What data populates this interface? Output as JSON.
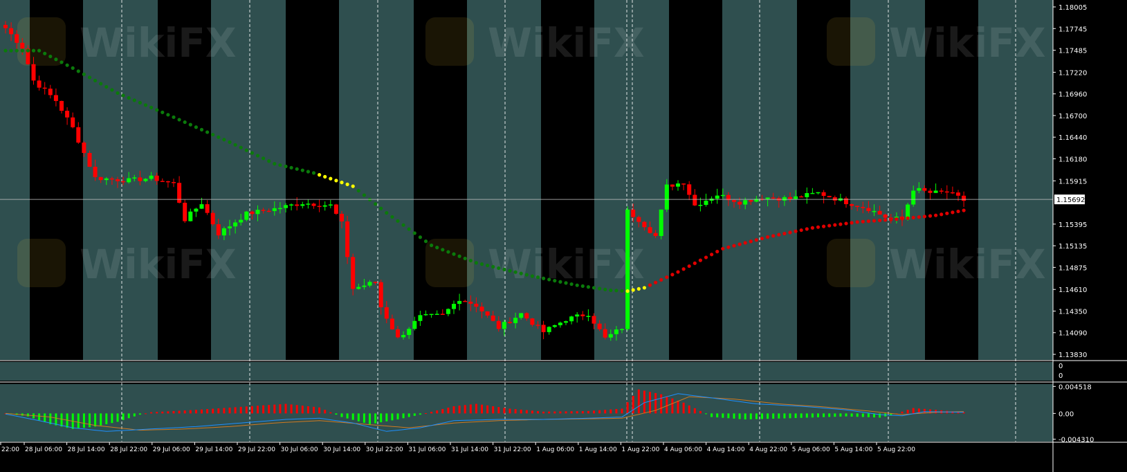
{
  "colors": {
    "background": "#2f4f4f",
    "session_band": "#000000",
    "candle_up": "#00ff00",
    "candle_down": "#ff0000",
    "ma_down": "#0b7a0b",
    "ma_up": "#e00000",
    "ma_flat": "#ffff00",
    "macd_line": "#1e90ff",
    "signal_line": "#d07a20",
    "hist_pos": "#ff0000",
    "hist_neg": "#00ff00",
    "grid": "#ffffff",
    "axis_text": "#ffffff",
    "price_marker": "#c0c0c0"
  },
  "watermark": {
    "text": "WikiFX",
    "logo": "wikifx-shield-logo"
  },
  "chart_data": [
    {
      "type": "candlestick",
      "name": "price",
      "ylim": [
        1.1383,
        1.18005
      ],
      "y_ticks": [
        "1.18005",
        "1.17745",
        "1.17485",
        "1.17220",
        "1.16960",
        "1.16700",
        "1.16440",
        "1.16180",
        "1.15915",
        "1.15395",
        "1.15135",
        "1.14875",
        "1.14610",
        "1.14350",
        "1.14090",
        "1.13830"
      ],
      "y_tick_values": [
        1.18005,
        1.17745,
        1.17485,
        1.1722,
        1.1696,
        1.167,
        1.1644,
        1.1618,
        1.15915,
        1.15395,
        1.15135,
        1.14875,
        1.1461,
        1.1435,
        1.1409,
        1.1383
      ],
      "current_price_label": "1.15692",
      "current_price": 1.15692,
      "x_labels": [
        "22:00",
        "28 Jul 06:00",
        "28 Jul 14:00",
        "28 Jul 22:00",
        "29 Jul 06:00",
        "29 Jul 14:00",
        "29 Jul 22:00",
        "30 Jul 06:00",
        "30 Jul 14:00",
        "30 Jul 22:00",
        "31 Jul 06:00",
        "31 Jul 14:00",
        "31 Jul 22:00",
        "1 Aug 06:00",
        "1 Aug 14:00",
        "1 Aug 22:00",
        "4 Aug 06:00",
        "4 Aug 14:00",
        "4 Aug 22:00",
        "5 Aug 06:00",
        "5 Aug 14:00",
        "5 Aug 22:00"
      ],
      "close_anchors": [
        [
          0,
          1.1775
        ],
        [
          3,
          1.1752
        ],
        [
          5,
          1.1712
        ],
        [
          9,
          1.1688
        ],
        [
          12,
          1.1655
        ],
        [
          16,
          1.1595
        ],
        [
          22,
          1.1592
        ],
        [
          26,
          1.1595
        ],
        [
          30,
          1.1588
        ],
        [
          32,
          1.1545
        ],
        [
          35,
          1.1565
        ],
        [
          38,
          1.1528
        ],
        [
          43,
          1.1552
        ],
        [
          48,
          1.1558
        ],
        [
          53,
          1.1565
        ],
        [
          58,
          1.1562
        ],
        [
          60,
          1.154
        ],
        [
          62,
          1.1462
        ],
        [
          66,
          1.147
        ],
        [
          67,
          1.144
        ],
        [
          70,
          1.1402
        ],
        [
          74,
          1.1428
        ],
        [
          78,
          1.143
        ],
        [
          81,
          1.145
        ],
        [
          84,
          1.1442
        ],
        [
          88,
          1.1415
        ],
        [
          92,
          1.1432
        ],
        [
          96,
          1.141
        ],
        [
          100,
          1.1425
        ],
        [
          104,
          1.1432
        ],
        [
          107,
          1.1402
        ],
        [
          110,
          1.1415
        ],
        [
          111,
          1.1555
        ],
        [
          113,
          1.1545
        ],
        [
          116,
          1.1525
        ],
        [
          118,
          1.1585
        ],
        [
          121,
          1.159
        ],
        [
          123,
          1.1562
        ],
        [
          127,
          1.1575
        ],
        [
          131,
          1.1566
        ],
        [
          135,
          1.1572
        ],
        [
          140,
          1.157
        ],
        [
          145,
          1.1577
        ],
        [
          150,
          1.1566
        ],
        [
          154,
          1.1558
        ],
        [
          157,
          1.1548
        ],
        [
          160,
          1.1545
        ],
        [
          162,
          1.1582
        ],
        [
          165,
          1.1577
        ],
        [
          168,
          1.1578
        ],
        [
          171,
          1.1568
        ]
      ],
      "candle_count": 172,
      "moving_average": {
        "anchors": [
          [
            0,
            1.1748
          ],
          [
            6,
            1.1748
          ],
          [
            12,
            1.1727
          ],
          [
            20,
            1.1697
          ],
          [
            30,
            1.1668
          ],
          [
            40,
            1.1638
          ],
          [
            48,
            1.1612
          ],
          [
            55,
            1.1601
          ],
          [
            62,
            1.1585
          ],
          [
            68,
            1.1553
          ],
          [
            76,
            1.1514
          ],
          [
            84,
            1.1493
          ],
          [
            94,
            1.1477
          ],
          [
            102,
            1.1466
          ],
          [
            108,
            1.146
          ],
          [
            111,
            1.1459
          ],
          [
            114,
            1.1463
          ],
          [
            120,
            1.1482
          ],
          [
            128,
            1.151
          ],
          [
            136,
            1.1524
          ],
          [
            144,
            1.1535
          ],
          [
            152,
            1.1542
          ],
          [
            160,
            1.1546
          ],
          [
            166,
            1.155
          ],
          [
            171,
            1.1556
          ]
        ],
        "color_segments": [
          [
            0,
            55,
            "down"
          ],
          [
            56,
            62,
            "flat"
          ],
          [
            63,
            110,
            "down"
          ],
          [
            111,
            114,
            "flat"
          ],
          [
            115,
            171,
            "up"
          ]
        ]
      }
    },
    {
      "type": "macd",
      "name": "MACD",
      "y_ticks": [
        "0.004518",
        "0.00",
        "-0.004310"
      ],
      "y_tick_values": [
        0.004518,
        0,
        -0.00431
      ],
      "ylim": [
        -0.0047,
        0.0049
      ],
      "histogram_anchors": [
        [
          0,
          0.0
        ],
        [
          4,
          -0.0005
        ],
        [
          8,
          -0.0018
        ],
        [
          12,
          -0.0026
        ],
        [
          16,
          -0.0022
        ],
        [
          20,
          -0.0014
        ],
        [
          24,
          -0.0002
        ],
        [
          26,
          0.0002
        ],
        [
          34,
          0.0006
        ],
        [
          42,
          0.0011
        ],
        [
          50,
          0.0016
        ],
        [
          56,
          0.001
        ],
        [
          60,
          -0.0006
        ],
        [
          65,
          -0.0018
        ],
        [
          70,
          -0.001
        ],
        [
          74,
          -0.0002
        ],
        [
          80,
          0.0012
        ],
        [
          84,
          0.0016
        ],
        [
          90,
          0.0008
        ],
        [
          96,
          0.0003
        ],
        [
          104,
          0.0004
        ],
        [
          110,
          0.0008
        ],
        [
          113,
          0.004
        ],
        [
          117,
          0.0032
        ],
        [
          121,
          0.0018
        ],
        [
          124,
          0.0004
        ],
        [
          126,
          -0.0006
        ],
        [
          132,
          -0.001
        ],
        [
          140,
          -0.0008
        ],
        [
          150,
          -0.0005
        ],
        [
          156,
          -0.0007
        ],
        [
          158,
          -0.0003
        ],
        [
          162,
          0.0009
        ],
        [
          166,
          0.0006
        ],
        [
          171,
          0.0002
        ]
      ],
      "macd_anchors": [
        [
          0,
          -0.0001
        ],
        [
          6,
          -0.0012
        ],
        [
          12,
          -0.0024
        ],
        [
          18,
          -0.003
        ],
        [
          26,
          -0.0026
        ],
        [
          34,
          -0.0022
        ],
        [
          42,
          -0.0016
        ],
        [
          50,
          -0.001
        ],
        [
          56,
          -0.0008
        ],
        [
          62,
          -0.0016
        ],
        [
          68,
          -0.003
        ],
        [
          74,
          -0.0024
        ],
        [
          80,
          -0.0012
        ],
        [
          88,
          -0.001
        ],
        [
          96,
          -0.001
        ],
        [
          104,
          -0.0008
        ],
        [
          110,
          -0.0006
        ],
        [
          114,
          0.0018
        ],
        [
          120,
          0.0033
        ],
        [
          126,
          0.0026
        ],
        [
          134,
          0.0016
        ],
        [
          142,
          0.0012
        ],
        [
          150,
          0.0006
        ],
        [
          156,
          -0.0002
        ],
        [
          160,
          -0.0004
        ],
        [
          164,
          0.0003
        ],
        [
          171,
          0.0002
        ]
      ],
      "signal_anchors": [
        [
          0,
          0.0
        ],
        [
          8,
          -0.0006
        ],
        [
          16,
          -0.002
        ],
        [
          24,
          -0.0028
        ],
        [
          32,
          -0.0026
        ],
        [
          40,
          -0.0022
        ],
        [
          48,
          -0.0016
        ],
        [
          56,
          -0.0012
        ],
        [
          64,
          -0.0018
        ],
        [
          72,
          -0.0024
        ],
        [
          80,
          -0.0016
        ],
        [
          88,
          -0.0012
        ],
        [
          96,
          -0.001
        ],
        [
          104,
          -0.0009
        ],
        [
          110,
          -0.0008
        ],
        [
          116,
          0.0005
        ],
        [
          122,
          0.0028
        ],
        [
          130,
          0.0024
        ],
        [
          138,
          0.0016
        ],
        [
          146,
          0.0011
        ],
        [
          154,
          0.0004
        ],
        [
          160,
          -0.0002
        ],
        [
          166,
          0.0002
        ],
        [
          171,
          0.0003
        ]
      ]
    },
    {
      "type": "indicator",
      "name": "empty-subwindow",
      "y_ticks": [
        "0",
        "0"
      ]
    }
  ]
}
